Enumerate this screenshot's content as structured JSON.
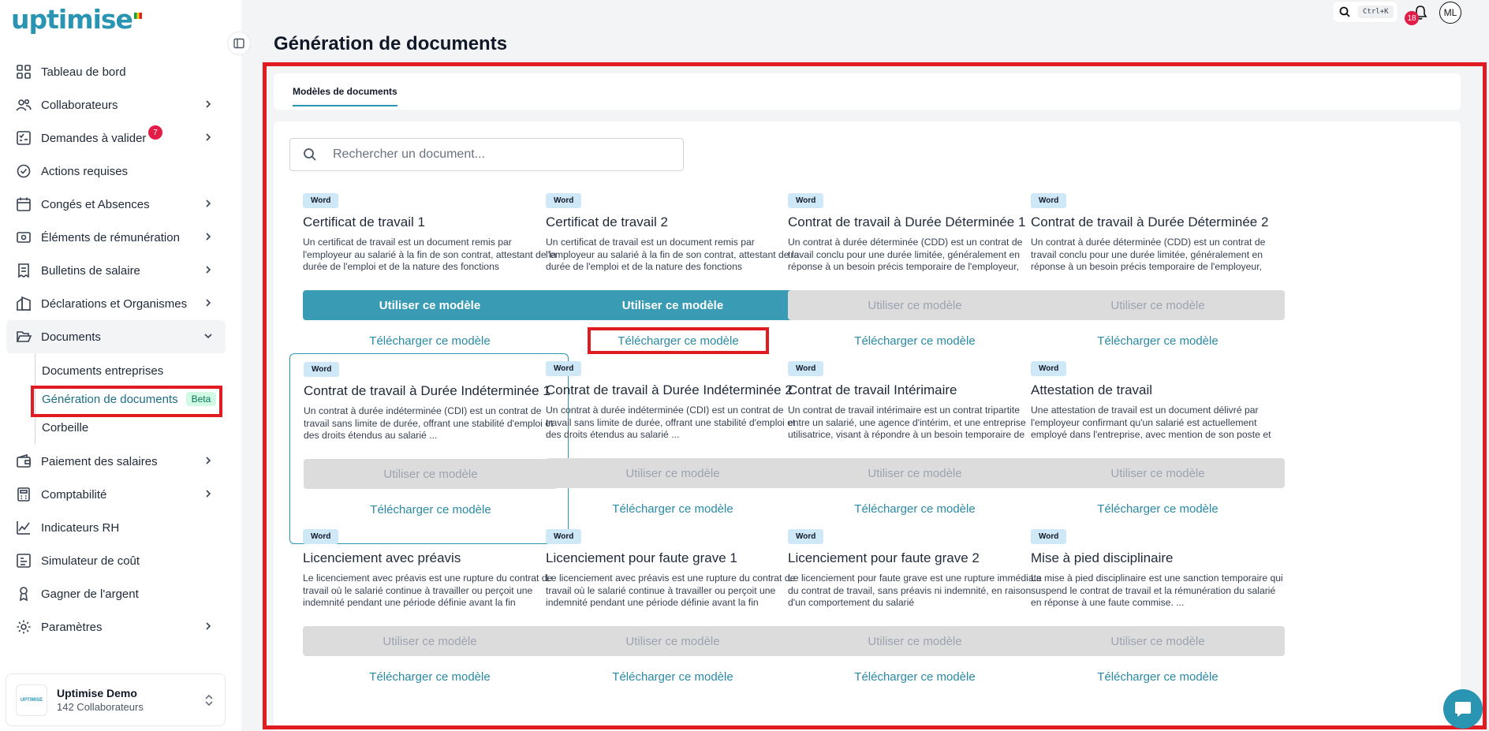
{
  "brand": {
    "logo_text": "uptimise"
  },
  "sidebar": {
    "items": [
      {
        "label": "Tableau de bord",
        "icon": "dashboard-grid-icon",
        "chevron": false
      },
      {
        "label": "Collaborateurs",
        "icon": "users-icon",
        "chevron": true
      },
      {
        "label": "Demandes à valider",
        "icon": "checklist-icon",
        "chevron": true,
        "badge": "7"
      },
      {
        "label": "Actions requises",
        "icon": "badge-check-icon",
        "chevron": false
      },
      {
        "label": "Congés et Absences",
        "icon": "calendar-icon",
        "chevron": true
      },
      {
        "label": "Éléments de rémunération",
        "icon": "money-icon",
        "chevron": true
      },
      {
        "label": "Bulletins de salaire",
        "icon": "receipt-icon",
        "chevron": true
      },
      {
        "label": "Déclarations et Organismes",
        "icon": "building-icon",
        "chevron": true
      },
      {
        "label": "Documents",
        "icon": "folder-open-icon",
        "chevron": true,
        "expanded": true
      }
    ],
    "documents_sub": [
      {
        "label": "Documents entreprises"
      },
      {
        "label": "Génération de documents",
        "badge": "Beta"
      },
      {
        "label": "Corbeille"
      }
    ],
    "items_after": [
      {
        "label": "Paiement des salaires",
        "icon": "wallet-icon",
        "chevron": true
      },
      {
        "label": "Comptabilité",
        "icon": "calculator-icon",
        "chevron": true
      },
      {
        "label": "Indicateurs RH",
        "icon": "chart-line-icon",
        "chevron": false
      },
      {
        "label": "Simulateur de coût",
        "icon": "simulator-icon",
        "chevron": false
      },
      {
        "label": "Gagner de l'argent",
        "icon": "medal-icon",
        "chevron": false
      },
      {
        "label": "Paramètres",
        "icon": "gear-icon",
        "chevron": true
      }
    ],
    "org": {
      "name": "Uptimise Demo",
      "count": "142 Collaborateurs",
      "logo_text": "UPTIMISE"
    }
  },
  "topbar": {
    "shortcut": "Ctrl+K",
    "notifications": "18",
    "avatar": "ML"
  },
  "page": {
    "title": "Génération de documents",
    "tab": "Modèles de documents",
    "search_placeholder": "Rechercher un document..."
  },
  "cards": [
    {
      "tag": "Word",
      "title": "Certificat de travail 1",
      "desc": "Un certificat de travail est un document remis par l'employeur au salarié à la fin de son contrat, attestant de la durée de l'emploi et de la nature des fonctions",
      "use": "Utiliser ce modèle",
      "download": "Télécharger ce modèle",
      "enabled": true
    },
    {
      "tag": "Word",
      "title": "Certificat de travail 2",
      "desc": "Un certificat de travail est un document remis par l'employeur au salarié à la fin de son contrat, attestant de la durée de l'emploi et de la nature des fonctions",
      "use": "Utiliser ce modèle",
      "download": "Télécharger ce modèle",
      "enabled": true
    },
    {
      "tag": "Word",
      "title": "Contrat de travail à Durée Déterminée 1",
      "desc": "Un contrat à durée déterminée (CDD) est un contrat de travail conclu pour une durée limitée, généralement en réponse à un besoin précis temporaire de l'employeur,",
      "use": "Utiliser ce modèle",
      "download": "Télécharger ce modèle",
      "enabled": false
    },
    {
      "tag": "Word",
      "title": "Contrat de travail à Durée Déterminée 2",
      "desc": "Un contrat à durée déterminée (CDD) est un contrat de travail conclu pour une durée limitée, généralement en réponse à un besoin précis temporaire de l'employeur,",
      "use": "Utiliser ce modèle",
      "download": "Télécharger ce modèle",
      "enabled": false
    },
    {
      "tag": "Word",
      "title": "Contrat de travail à Durée Indéterminée 1",
      "desc": "Un contrat à durée indéterminée (CDI) est un contrat de travail sans limite de durée, offrant une stabilité d'emploi et des droits étendus au salarié ...",
      "use": "Utiliser ce modèle",
      "download": "Télécharger ce modèle",
      "enabled": false
    },
    {
      "tag": "Word",
      "title": "Contrat de travail à Durée Indéterminée 2",
      "desc": "Un contrat à durée indéterminée (CDI) est un contrat de travail sans limite de durée, offrant une stabilité d'emploi et des droits étendus au salarié ...",
      "use": "Utiliser ce modèle",
      "download": "Télécharger ce modèle",
      "enabled": false
    },
    {
      "tag": "Word",
      "title": "Contrat de travail Intérimaire",
      "desc": "Un contrat de travail intérimaire est un contrat tripartite entre un salarié, une agence d'intérim, et une entreprise utilisatrice, visant à répondre à un besoin temporaire de",
      "use": "Utiliser ce modèle",
      "download": "Télécharger ce modèle",
      "enabled": false
    },
    {
      "tag": "Word",
      "title": "Attestation de travail",
      "desc": "Une attestation de travail est un document délivré par l'employeur confirmant qu'un salarié est actuellement employé dans l'entreprise, avec mention de son poste et",
      "use": "Utiliser ce modèle",
      "download": "Télécharger ce modèle",
      "enabled": false
    },
    {
      "tag": "Word",
      "title": "Licenciement avec préavis",
      "desc": "Le licenciement avec préavis est une rupture du contrat de travail où le salarié continue à travailler ou perçoit une indemnité pendant une période définie avant la fin",
      "use": "Utiliser ce modèle",
      "download": "Télécharger ce modèle",
      "enabled": false
    },
    {
      "tag": "Word",
      "title": "Licenciement pour faute grave 1",
      "desc": "Le licenciement avec préavis est une rupture du contrat de travail où le salarié continue à travailler ou perçoit une indemnité pendant une période définie avant la fin",
      "use": "Utiliser ce modèle",
      "download": "Télécharger ce modèle",
      "enabled": false
    },
    {
      "tag": "Word",
      "title": "Licenciement pour faute grave 2",
      "desc": "Le licenciement pour faute grave est une rupture immédiate du contrat de travail, sans préavis ni indemnité, en raison d'un comportement du salarié",
      "use": "Utiliser ce modèle",
      "download": "Télécharger ce modèle",
      "enabled": false
    },
    {
      "tag": "Word",
      "title": "Mise à pied disciplinaire",
      "desc": "La mise à pied disciplinaire est une sanction temporaire qui suspend le contrat de travail et la rémunération du salarié en réponse à une faute commise. ...",
      "use": "Utiliser ce modèle",
      "download": "Télécharger ce modèle",
      "enabled": false
    }
  ],
  "colors": {
    "accent": "#2a95b3",
    "button": "#3a9cb4",
    "highlight": "#e01b22"
  }
}
